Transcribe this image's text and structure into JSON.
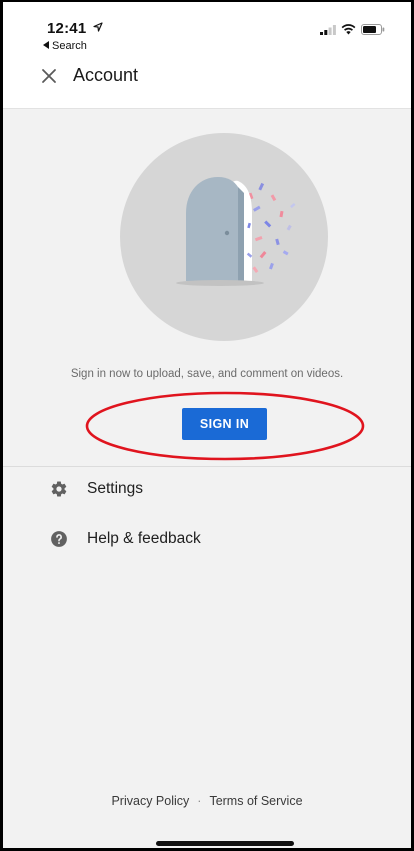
{
  "status_bar": {
    "time": "12:41",
    "back_app_label": "Search"
  },
  "header": {
    "title": "Account"
  },
  "main": {
    "prompt": "Sign in now to upload, save, and comment on videos.",
    "sign_in_label": "SIGN IN"
  },
  "menu": {
    "items": [
      {
        "label": "Settings",
        "icon": "gear-icon"
      },
      {
        "label": "Help & feedback",
        "icon": "help-icon"
      }
    ]
  },
  "footer": {
    "privacy_label": "Privacy Policy",
    "separator": "·",
    "terms_label": "Terms of Service"
  },
  "colors": {
    "accent": "#1a6ad6",
    "annotation": "#e0141e",
    "background": "#f2f2f2"
  }
}
